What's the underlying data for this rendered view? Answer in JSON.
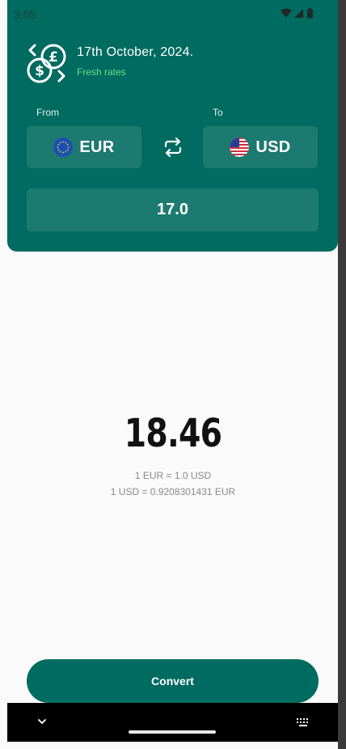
{
  "status_bar": {
    "time": "3:05"
  },
  "header": {
    "date": "17th October, 2024.",
    "freshness": "Fresh rates",
    "from_label": "From",
    "to_label": "To",
    "from_currency": "EUR",
    "to_currency": "USD",
    "amount": "17.0"
  },
  "result": {
    "value": "18.46",
    "rate_from": "1 EUR = 1.0 USD",
    "rate_to": "1 USD = 0.9208301431 EUR"
  },
  "actions": {
    "convert_label": "Convert"
  },
  "colors": {
    "brand": "#006b60",
    "field": "#1d7a70",
    "fresh": "#6ee07f",
    "background": "#fafafa"
  },
  "icons": [
    "currency-exchange-logo-icon",
    "eu-flag-icon",
    "us-flag-icon",
    "swap-icon",
    "wifi-icon",
    "signal-icon",
    "battery-icon",
    "chevron-down-icon",
    "keyboard-icon"
  ]
}
